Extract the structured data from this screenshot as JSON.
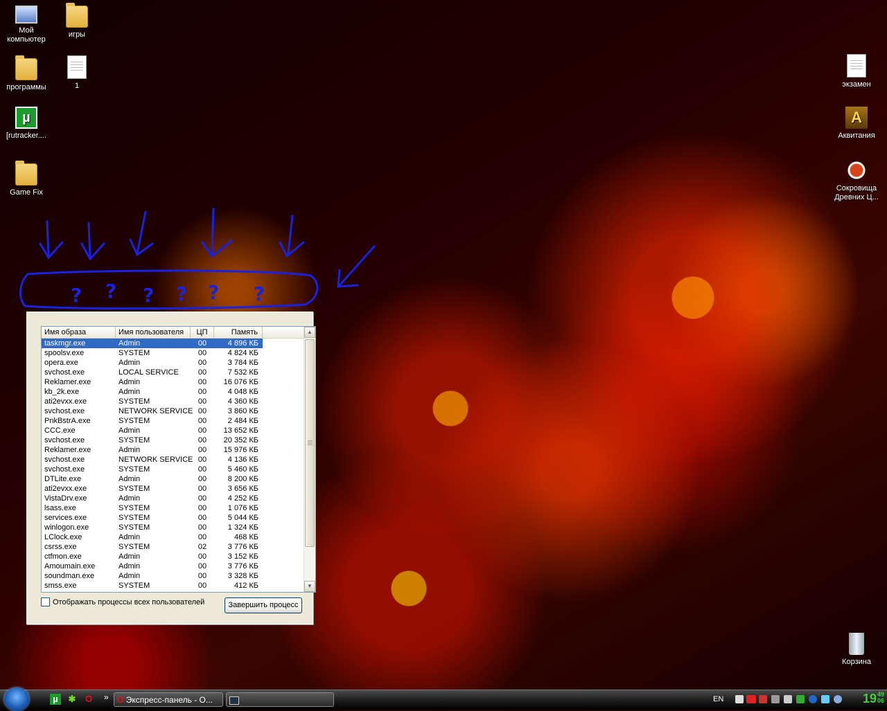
{
  "desktop": {
    "icons": [
      {
        "label": "Мой компьютер",
        "icon": "my-computer-icon"
      },
      {
        "label": "игры",
        "icon": "folder-icon"
      },
      {
        "label": "программы",
        "icon": "folder-icon"
      },
      {
        "label": "1",
        "icon": "document-icon"
      },
      {
        "label": "[rutracker....",
        "icon": "utorrent-icon"
      },
      {
        "label": "Game Fix",
        "icon": "folder-icon"
      },
      {
        "label": "экзамен",
        "icon": "document-icon"
      },
      {
        "label": "Аквитания",
        "icon": "game-icon"
      },
      {
        "label": "Сокровища Древних Ц...",
        "icon": "bug-game-icon"
      },
      {
        "label": "Корзина",
        "icon": "recycle-bin-icon"
      }
    ]
  },
  "annotation": {
    "question_mark": "?",
    "color": "#1a22e0"
  },
  "task_manager": {
    "columns": [
      "Имя образа",
      "Имя пользователя",
      "ЦП",
      "Память"
    ],
    "rows": [
      [
        "taskmgr.exe",
        "Admin",
        "00",
        "4 896 КБ"
      ],
      [
        "spoolsv.exe",
        "SYSTEM",
        "00",
        "4 824 КБ"
      ],
      [
        "opera.exe",
        "Admin",
        "00",
        "3 784 КБ"
      ],
      [
        "svchost.exe",
        "LOCAL SERVICE",
        "00",
        "7 532 КБ"
      ],
      [
        "Reklamer.exe",
        "Admin",
        "00",
        "16 076 КБ"
      ],
      [
        "kb_2k.exe",
        "Admin",
        "00",
        "4 048 КБ"
      ],
      [
        "ati2evxx.exe",
        "SYSTEM",
        "00",
        "4 360 КБ"
      ],
      [
        "svchost.exe",
        "NETWORK SERVICE",
        "00",
        "3 860 КБ"
      ],
      [
        "PnkBstrA.exe",
        "SYSTEM",
        "00",
        "2 484 КБ"
      ],
      [
        "CCC.exe",
        "Admin",
        "00",
        "13 652 КБ"
      ],
      [
        "svchost.exe",
        "SYSTEM",
        "00",
        "20 352 КБ"
      ],
      [
        "Reklamer.exe",
        "Admin",
        "00",
        "15 976 КБ"
      ],
      [
        "svchost.exe",
        "NETWORK SERVICE",
        "00",
        "4 136 КБ"
      ],
      [
        "svchost.exe",
        "SYSTEM",
        "00",
        "5 460 КБ"
      ],
      [
        "DTLite.exe",
        "Admin",
        "00",
        "8 200 КБ"
      ],
      [
        "ati2evxx.exe",
        "SYSTEM",
        "00",
        "3 656 КБ"
      ],
      [
        "VistaDrv.exe",
        "Admin",
        "00",
        "4 252 КБ"
      ],
      [
        "lsass.exe",
        "SYSTEM",
        "00",
        "1 076 КБ"
      ],
      [
        "services.exe",
        "SYSTEM",
        "00",
        "5 044 КБ"
      ],
      [
        "winlogon.exe",
        "SYSTEM",
        "00",
        "1 324 КБ"
      ],
      [
        "LClock.exe",
        "Admin",
        "00",
        "468 КБ"
      ],
      [
        "csrss.exe",
        "SYSTEM",
        "02",
        "3 776 КБ"
      ],
      [
        "ctfmon.exe",
        "Admin",
        "00",
        "3 152 КБ"
      ],
      [
        "Amoumain.exe",
        "Admin",
        "00",
        "3 776 КБ"
      ],
      [
        "soundman.exe",
        "Admin",
        "00",
        "3 328 КБ"
      ],
      [
        "smss.exe",
        "SYSTEM",
        "00",
        "412 КБ"
      ]
    ],
    "selected_row": 0,
    "show_all_users_label": "Отображать процессы всех пользователей",
    "show_all_users_checked": false,
    "end_process_label": "Завершить процесс"
  },
  "taskbar": {
    "quicklaunch_more": "»",
    "buttons": [
      {
        "label": "Экспресс-панель - О..."
      },
      {
        "label": ""
      }
    ],
    "tray": {
      "language": "EN",
      "clock_time": "19",
      "clock_minutes": "49",
      "clock_seconds": "06"
    }
  }
}
